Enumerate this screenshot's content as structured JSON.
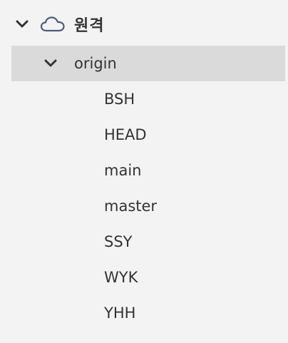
{
  "section": {
    "label": "원격",
    "icon": "cloud-icon",
    "expanded": true
  },
  "remote": {
    "name": "origin",
    "expanded": true,
    "selected": true
  },
  "branches": [
    "BSH",
    "HEAD",
    "main",
    "master",
    "SSY",
    "WYK",
    "YHH"
  ],
  "colors": {
    "background": "#f3f3f3",
    "selected_row": "#dadada",
    "text": "#333333",
    "icon": "#4f5b7a"
  }
}
